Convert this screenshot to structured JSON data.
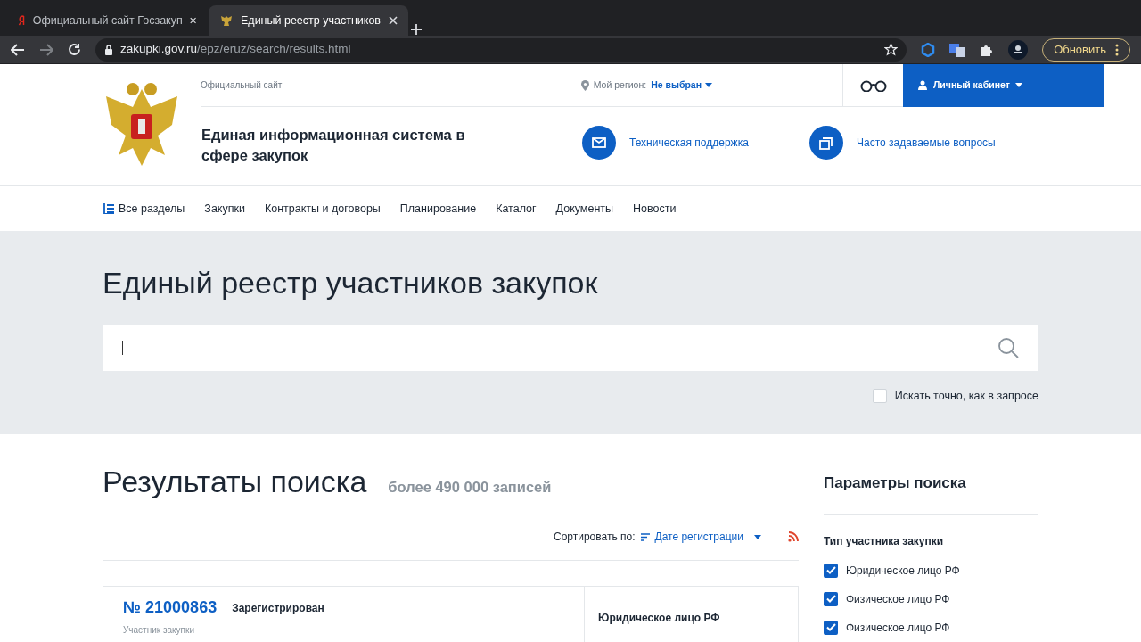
{
  "browser": {
    "tabs": [
      {
        "title": "Официальный сайт Госзакуп",
        "selected": false
      },
      {
        "title": "Единый реестр участников",
        "selected": true
      }
    ],
    "url_host": "zakupki.gov.ru",
    "url_path": "/epz/eruz/search/results.html",
    "update_button": "Обновить"
  },
  "header": {
    "official": "Официальный сайт",
    "region_label": "Мой регион:",
    "region_value": "Не выбран",
    "cabinet": "Личный кабинет",
    "site_title": "Единая информационная система в сфере закупок",
    "support": "Техническая поддержка",
    "faq": "Часто задаваемые вопросы"
  },
  "nav": [
    "Все разделы",
    "Закупки",
    "Контракты и договоры",
    "Планирование",
    "Каталог",
    "Документы",
    "Новости"
  ],
  "search": {
    "heading": "Единый реестр участников закупок",
    "exact_label": "Искать точно, как в запросе",
    "exact_checked": false
  },
  "results": {
    "heading": "Результаты поиска",
    "count": "более 490 000 записей",
    "sort_label": "Сортировать по:",
    "sort_value": "Дате регистрации",
    "cards": [
      {
        "number": "№ 21000863",
        "status": "Зарегистрирован",
        "field_label": "Участник закупки",
        "type": "Юридическое лицо РФ"
      }
    ]
  },
  "params": {
    "heading": "Параметры поиска",
    "group": "Тип участника закупки",
    "options": [
      {
        "label": "Юридическое лицо РФ",
        "checked": true
      },
      {
        "label": "Физическое лицо РФ",
        "checked": true
      },
      {
        "label": "Физическое лицо РФ",
        "checked": true
      }
    ]
  }
}
